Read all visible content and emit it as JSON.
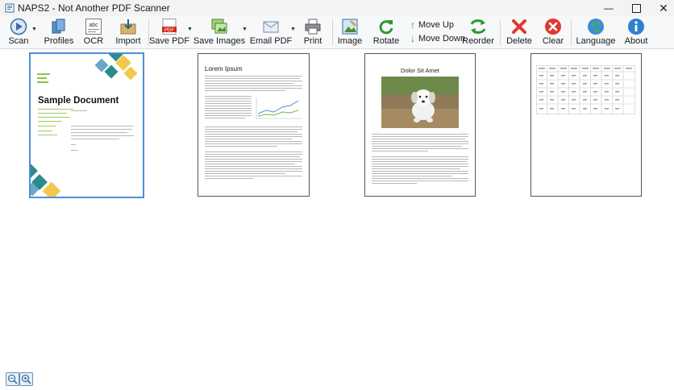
{
  "window": {
    "title": "NAPS2 - Not Another PDF Scanner"
  },
  "toolbar": {
    "scan": "Scan",
    "profiles": "Profiles",
    "ocr": "OCR",
    "import": "Import",
    "save_pdf": "Save PDF",
    "save_images": "Save Images",
    "email_pdf": "Email PDF",
    "print": "Print",
    "image": "Image",
    "rotate": "Rotate",
    "move_up": "Move Up",
    "move_down": "Move Down",
    "reorder": "Reorder",
    "delete": "Delete",
    "clear": "Clear",
    "language": "Language",
    "about": "About",
    "ocr_icon_text": "abc",
    "pdf_icon_text": "PDF"
  },
  "pages": [
    {
      "heading": "Sample Document",
      "selected": true
    },
    {
      "heading": "Lorem Ipsum",
      "selected": false
    },
    {
      "heading": "Dolor Sit Amet",
      "selected": false
    },
    {
      "heading": "",
      "selected": false
    }
  ],
  "colors": {
    "selection": "#4a90d9",
    "accent_green": "#2e9a2e",
    "delete_red": "#e03a2e",
    "teal": "#2d8a8a",
    "yellow": "#f2c94c"
  }
}
